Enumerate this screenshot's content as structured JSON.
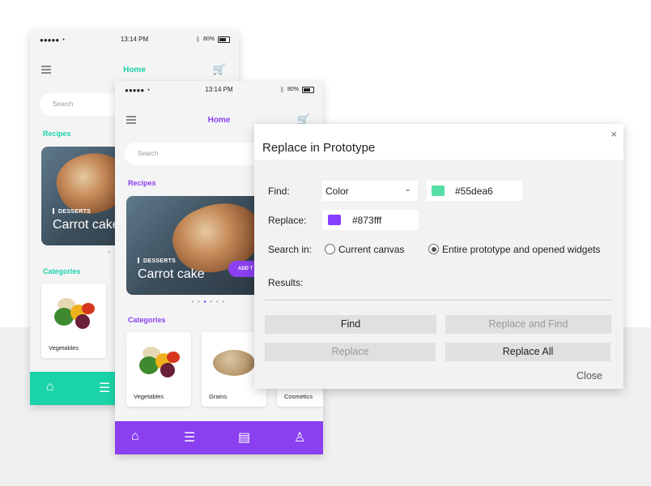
{
  "colors": {
    "teal": "#1bd3a8",
    "purple": "#8a3ff0",
    "find_swatch": "#55dea6",
    "replace_swatch": "#873fff"
  },
  "status_bar": {
    "signal": "●●●●●",
    "time": "13:14 PM",
    "battery": "80%"
  },
  "phone_back": {
    "nav_title": "Home",
    "search_placeholder": "Search",
    "recipes_label": "Recipes",
    "hero_tag": "DESSERTS",
    "hero_title": "Carrot cake",
    "categories_label": "Categories",
    "categories": [
      "Vegetables"
    ],
    "tabs": [
      "home-icon",
      "list-icon"
    ]
  },
  "phone_front": {
    "nav_title": "Home",
    "search_placeholder": "Search",
    "recipes_label": "Recipes",
    "hero_tag": "DESSERTS",
    "hero_title": "Carrot cake",
    "add_button": "ADD T",
    "carousel_active_index": 3,
    "categories_label": "Categories",
    "categories": [
      "Vegetables",
      "Grains",
      "Cosmetics"
    ],
    "tabs": [
      "home-icon",
      "list-icon",
      "document-icon",
      "user-icon"
    ]
  },
  "dialog": {
    "title": "Replace in Prototype",
    "close_icon": "×",
    "find_label": "Find:",
    "find_type": "Color",
    "find_value": "#55dea6",
    "replace_label": "Replace:",
    "replace_value": "#873fff",
    "search_in_label": "Search in:",
    "scope_options": [
      "Current canvas",
      "Entire prototype and opened widgets"
    ],
    "scope_selected": 1,
    "results_label": "Results:",
    "buttons": {
      "find": "Find",
      "replace_and_find": "Replace and Find",
      "replace": "Replace",
      "replace_all": "Replace All"
    },
    "close": "Close"
  }
}
